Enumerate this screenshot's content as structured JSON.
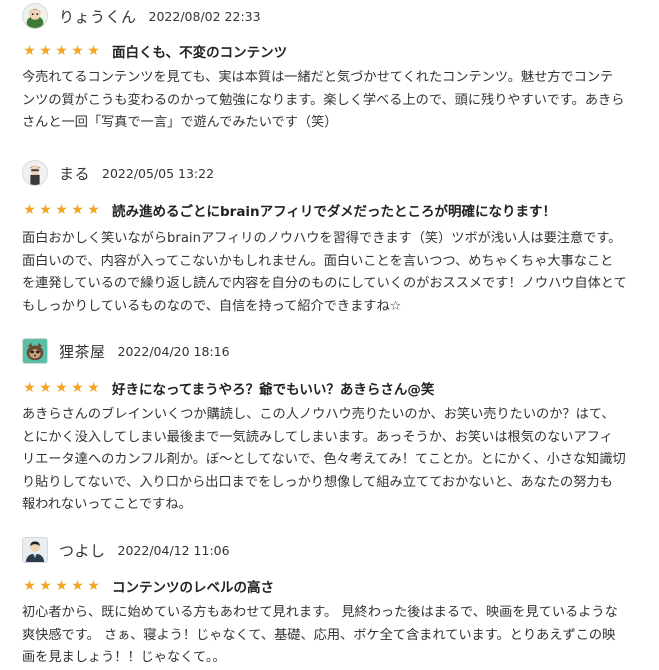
{
  "reviews": [
    {
      "username": "りょうくん",
      "date": "2022/08/02 22:33",
      "avatar_icon": "green-character-avatar-icon",
      "rating": 5,
      "stars": [
        "★",
        "★",
        "★",
        "★",
        "★"
      ],
      "title": "面白くも、不変のコンテンツ",
      "body": "今売れてるコンテンツを見ても、実は本質は一緒だと気づかせてくれたコンテンツ。魅せ方でコンテ\nンツの質がこうも変わるのかって勉強になります。楽しく学べる上ので、頭に残りやすいです。あきら\nさんと一回「写真で一言」で遊んでみたいです（笑）"
    },
    {
      "username": "まる",
      "date": "2022/05/05 13:22",
      "avatar_icon": "person-avatar-icon",
      "rating": 5,
      "stars": [
        "★",
        "★",
        "★",
        "★",
        "★"
      ],
      "title": "読み進めるごとにbrainアフィリでダメだったところが明確になります！",
      "body": "面白おかしく笑いながらbrainアフィリのノウハウを習得できます（笑）ツボが浅い人は要注意です。\n面白いので、内容が入ってこないかもしれません。面白いことを言いつつ、めちゃくちゃ大事なこと\nを連発しているので繰り返し読んで内容を自分のものにしていくのがおススメです！ノウハウ自体とて\nもしっかりしているものなので、自信を持って紹介できますね☆"
    },
    {
      "username": "狸茶屋",
      "date": "2022/04/20 18:16",
      "avatar_icon": "tanuki-avatar-icon",
      "rating": 5,
      "stars": [
        "★",
        "★",
        "★",
        "★",
        "★"
      ],
      "title": "好きになってまうやろ？爺でもいい？あきらさん@笑",
      "body": "あきらさんのブレインいくつか購読し、この人ノウハウ売りたいのか、お笑い売りたいのか？はて、\nとにかく没入してしまい最後まで一気読みしてしまいます。あっそうか、お笑いは根気のないアフィ\nリエータ達へのカンフル剤か。ぼ〜としてないで、色々考えてみ！てことか。とにかく、小さな知識切\nり貼りしてないで、入り口から出口までをしっかり想像して組み立てておかないと、あなたの努力も\n報われないってことですね。"
    },
    {
      "username": "つよし",
      "date": "2022/04/12 11:06",
      "avatar_icon": "man-in-suit-avatar-icon",
      "rating": 5,
      "stars": [
        "★",
        "★",
        "★",
        "★",
        "★"
      ],
      "title": "コンテンツのレベルの高さ",
      "body": "初心者から、既に始めている方もあわせて見れます。 見終わった後はまるで、映画を見ているような\n爽快感です。 さぁ、寝よう！じゃなくて、基礎、応用、ボケ全て含まれています。とりあえずこの映\n画を見ましょう！！じゃなくて。。"
    }
  ],
  "colors": {
    "star": "#f5a623",
    "text": "#333333",
    "title": "#222222",
    "background": "#ffffff"
  }
}
